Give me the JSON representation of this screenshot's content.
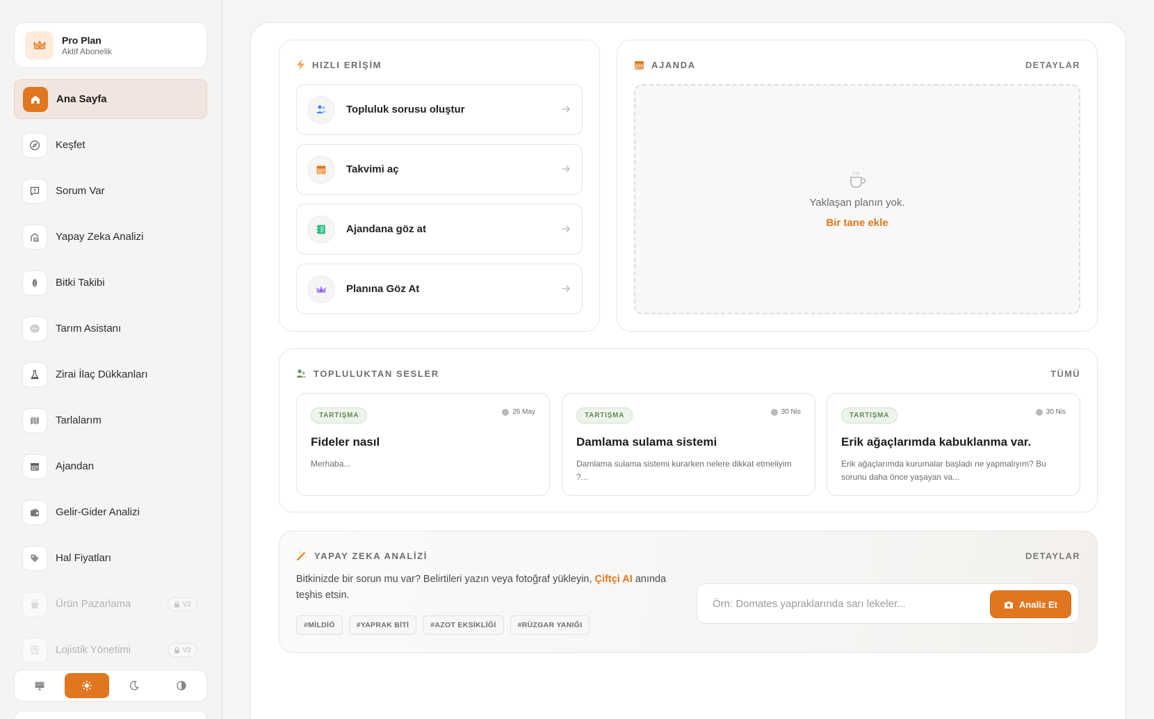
{
  "sidebar": {
    "plan": {
      "title": "Pro Plan",
      "subtitle": "Aktif Abonelik"
    },
    "items": [
      {
        "label": "Ana Sayfa",
        "icon": "home-icon",
        "active": true
      },
      {
        "label": "Keşfet",
        "icon": "compass-icon"
      },
      {
        "label": "Sorum Var",
        "icon": "question-message-icon"
      },
      {
        "label": "Yapay Zeka Analizi",
        "icon": "ai-scan-icon"
      },
      {
        "label": "Bitki Takibi",
        "icon": "leaf-icon"
      },
      {
        "label": "Tarım Asistanı",
        "icon": "chat-bubble-icon"
      },
      {
        "label": "Zirai İlaç Dükkanları",
        "icon": "flask-icon"
      },
      {
        "label": "Tarlalarım",
        "icon": "map-icon"
      },
      {
        "label": "Ajandan",
        "icon": "calendar-icon"
      },
      {
        "label": "Gelir-Gider Analizi",
        "icon": "wallet-icon"
      },
      {
        "label": "Hal Fiyatları",
        "icon": "tag-icon"
      },
      {
        "label": "Ürün Pazarlama",
        "icon": "shopping-bag-icon",
        "disabled": true,
        "badge": "V2"
      },
      {
        "label": "Lojistik Yönetimi",
        "icon": "truck-icon",
        "disabled": true,
        "badge": "V2"
      }
    ],
    "theme_modes": [
      "system",
      "light",
      "dark",
      "contrast"
    ],
    "theme_active": "light"
  },
  "quick_access": {
    "title": "HIZLI ERİŞİM",
    "items": [
      {
        "label": "Topluluk sorusu oluştur",
        "icon": "people-icon"
      },
      {
        "label": "Takvimi aç",
        "icon": "calendar-icon"
      },
      {
        "label": "Ajandana göz at",
        "icon": "notebook-icon"
      },
      {
        "label": "Planına Göz At",
        "icon": "crown-icon"
      }
    ]
  },
  "agenda": {
    "title": "AJANDA",
    "link": "DETAYLAR",
    "empty_text": "Yaklaşan planın yok.",
    "add_link": "Bir tane ekle"
  },
  "community": {
    "title": "TOPLULUKTAN SESLER",
    "link": "TÜMÜ",
    "posts": [
      {
        "tag": "TARTIŞMA",
        "date": "26 May",
        "title": "Fideler nasıl",
        "body": "Merhaba..."
      },
      {
        "tag": "TARTIŞMA",
        "date": "30 Nis",
        "title": "Damlama sulama sistemi",
        "body": "Damlama sulama sistemi kurarken nelere dikkat etmeliyim ?..."
      },
      {
        "tag": "TARTIŞMA",
        "date": "30 Nis",
        "title": "Erik ağaçlarımda kabuklanma var.",
        "body": "Erik ağaçlarımda kurumalar başladı ne yapmalıyım? Bu sorunu daha önce yaşayan va..."
      }
    ]
  },
  "ai_analysis": {
    "title": "YAPAY ZEKA ANALİZİ",
    "link": "DETAYLAR",
    "text_before": "Bitkinizde bir sorun mu var? Belirtileri yazın veya fotoğraf yükleyin, ",
    "brand": "Çiftçi AI",
    "text_after": " anında teşhis etsin.",
    "chips": [
      "#MİLDİÖ",
      "#YAPRAK BİTİ",
      "#AZOT EKSİKLİĞİ",
      "#RÜZGAR YANIĞI"
    ],
    "input_placeholder": "Örn: Domates yapraklarında sarı lekeler...",
    "input_value": "",
    "button_label": "Analiz Et"
  },
  "colors": {
    "accent": "#e0761f",
    "tag_green": "#5f8a4f",
    "active_bg": "#f1e6df"
  }
}
